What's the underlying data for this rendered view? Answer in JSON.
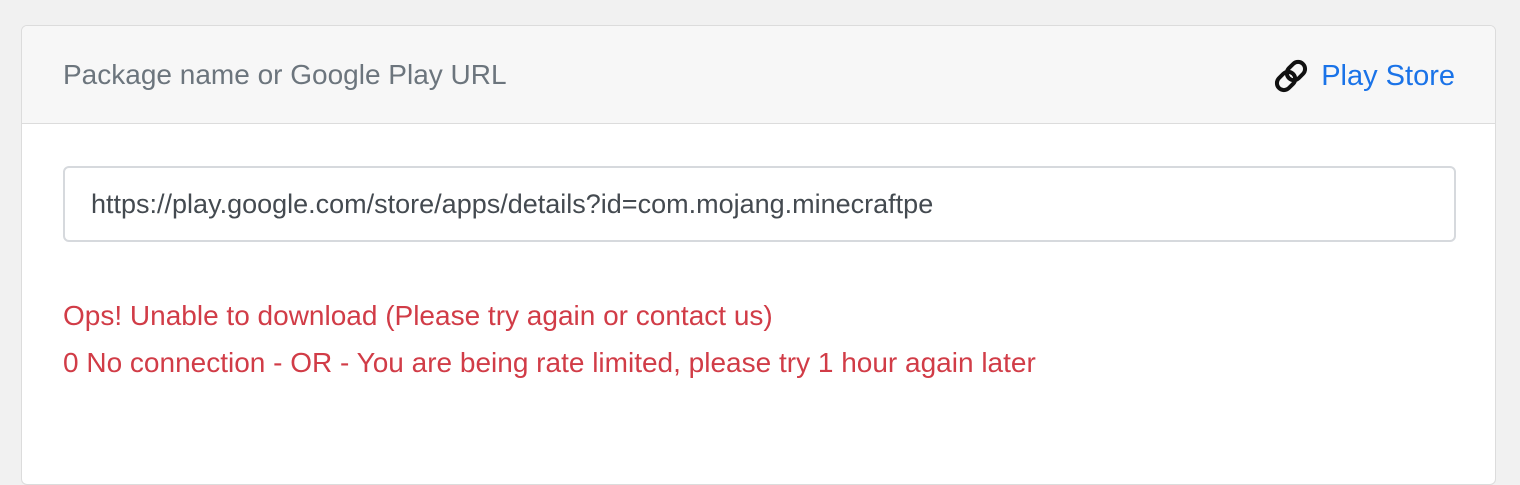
{
  "header": {
    "title": "Package name or Google Play URL",
    "store_link_label": "Play Store",
    "store_link_icon": "link-icon"
  },
  "form": {
    "url_value": "https://play.google.com/store/apps/details?id=com.mojang.minecraftpe"
  },
  "errors": {
    "line1": "Ops! Unable to download (Please try again or contact us)",
    "line2": "0 No connection - OR - You are being rate limited, please try 1 hour again later"
  },
  "colors": {
    "link": "#1a73e8",
    "error": "#d13c47",
    "header_text": "#6c757d"
  }
}
